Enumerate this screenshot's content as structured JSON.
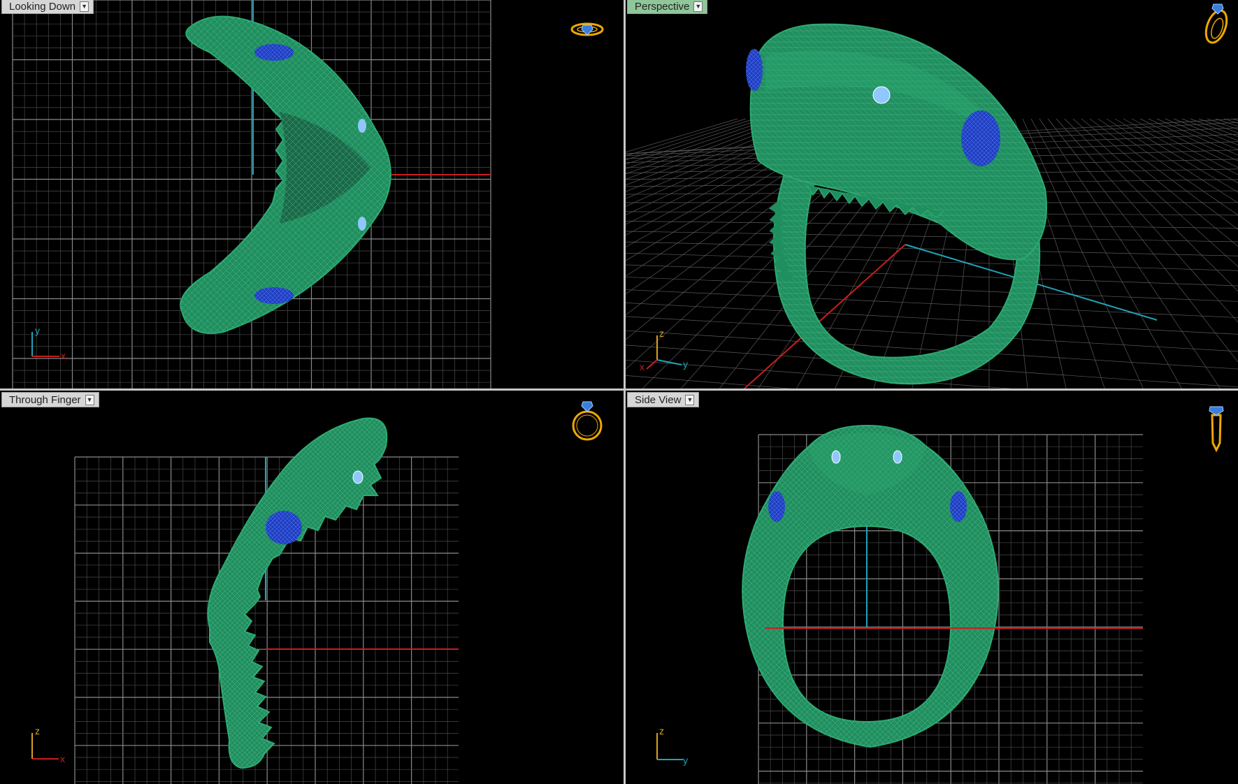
{
  "viewports": {
    "looking_down": {
      "label": "Looking Down",
      "axis_h": "x",
      "axis_v": "y"
    },
    "perspective": {
      "label": "Perspective",
      "axis_h": "y",
      "axis_v": "z",
      "axis_d": "x"
    },
    "through_finger": {
      "label": "Through Finger",
      "axis_h": "x",
      "axis_v": "z"
    },
    "side_view": {
      "label": "Side View",
      "axis_h": "y",
      "axis_v": "z"
    }
  },
  "colors": {
    "model": "#1f8f5f",
    "wire": "#9fe3bf",
    "gem": "#1f3fbf",
    "gem_light": "#8fc7ff",
    "grid": "#6f6f6f",
    "axis_x": "#c81e1e",
    "axis_y": "#1fa3b8",
    "axis_z": "#d9a020",
    "view_icon": "#f0a800"
  },
  "icons": {
    "looking_down": "ring-top-view-icon",
    "perspective": "ring-perspective-icon",
    "through_finger": "ring-front-view-icon",
    "side_view": "ring-side-view-icon"
  }
}
